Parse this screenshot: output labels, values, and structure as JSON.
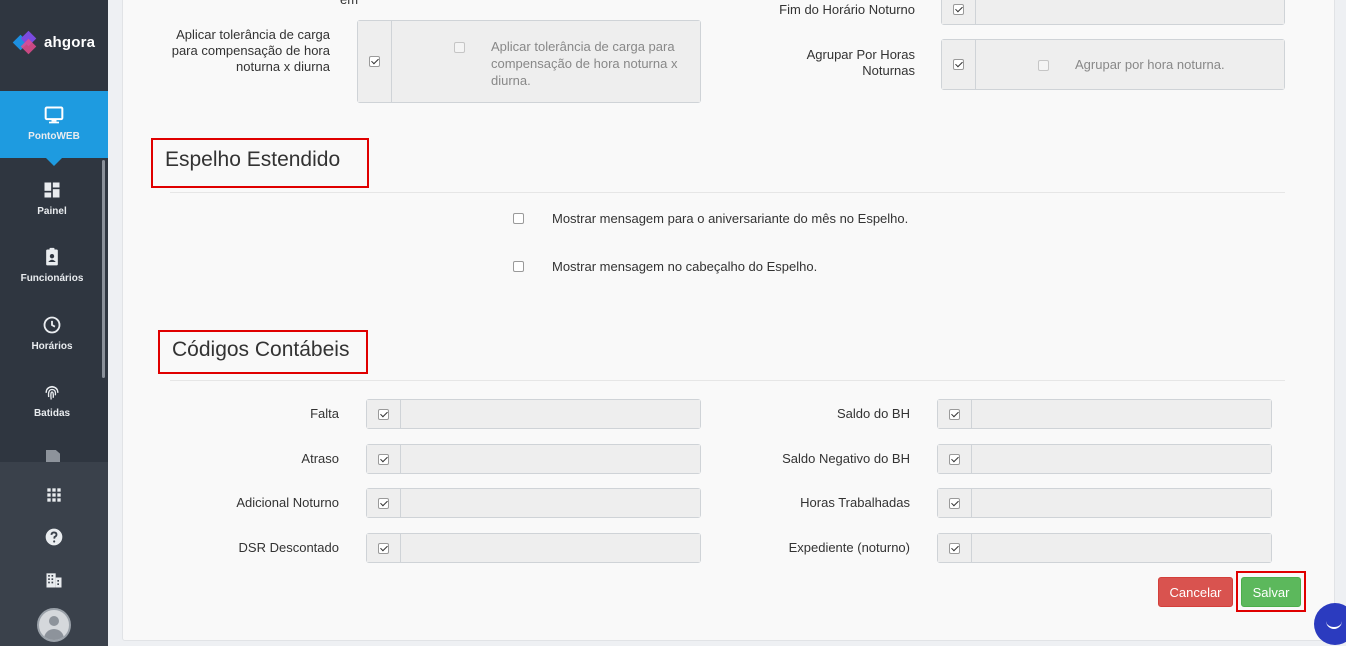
{
  "brand": {
    "name": "ahgora"
  },
  "sidebar": {
    "active": {
      "label": "PontoWEB",
      "icon": "monitor-icon"
    },
    "items": [
      {
        "label": "Painel",
        "icon": "dashboard-icon"
      },
      {
        "label": "Funcionários",
        "icon": "badge-icon"
      },
      {
        "label": "Horários",
        "icon": "clock-icon"
      },
      {
        "label": "Batidas",
        "icon": "fingerprint-icon"
      }
    ],
    "bottom_icons": [
      "apps-grid-icon",
      "help-icon",
      "building-icon",
      "user-avatar-icon"
    ]
  },
  "top_fields": {
    "cut_text": "em",
    "tolerancia": {
      "label": "Aplicar tolerância de carga para compensação de hora noturna x diurna",
      "inner_text": "Aplicar tolerância de carga para compensação de hora noturna x diurna."
    },
    "fim_noturno": {
      "label": "Fim do Horário Noturno"
    },
    "agrupar": {
      "label": "Agrupar Por Horas Noturnas",
      "inner_text": "Agrupar por hora noturna."
    }
  },
  "espelho": {
    "title": "Espelho Estendido",
    "options": [
      "Mostrar mensagem para o aniversariante do mês no Espelho.",
      "Mostrar mensagem no cabeçalho do Espelho."
    ]
  },
  "codigos": {
    "title": "Códigos Contábeis",
    "left": [
      "Falta",
      "Atraso",
      "Adicional Noturno",
      "DSR Descontado"
    ],
    "right": [
      "Saldo do BH",
      "Saldo Negativo do BH",
      "Horas Trabalhadas",
      "Expediente (noturno)"
    ]
  },
  "actions": {
    "cancel": "Cancelar",
    "save": "Salvar"
  }
}
